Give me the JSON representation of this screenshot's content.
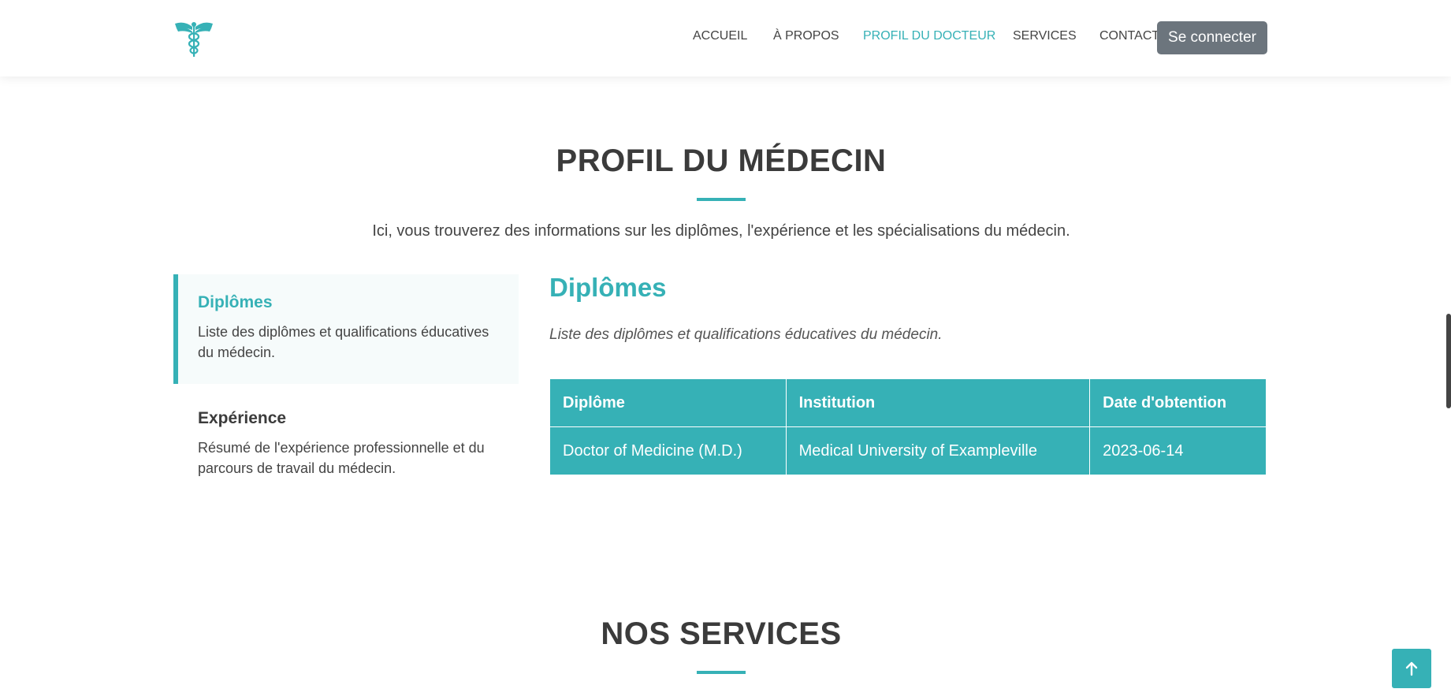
{
  "nav": {
    "items": [
      {
        "label": "ACCUEIL",
        "active": false
      },
      {
        "label": "À PROPOS",
        "active": false
      },
      {
        "label": "PROFIL DU DOCTEUR",
        "active": true
      },
      {
        "label": "SERVICES",
        "active": false
      },
      {
        "label": "CONTACT",
        "active": false
      }
    ],
    "login_label": "Se connecter"
  },
  "profile": {
    "title": "PROFIL DU MÉDECIN",
    "description": "Ici, vous trouverez des informations sur les diplômes, l'expérience et les spécialisations du médecin.",
    "tabs": [
      {
        "title": "Diplômes",
        "text": "Liste des diplômes et qualifications éducatives du médecin.",
        "active": true
      },
      {
        "title": "Expérience",
        "text": "Résumé de l'expérience professionnelle et du parcours de travail du médecin.",
        "active": false
      }
    ],
    "content": {
      "title": "Diplômes",
      "description": "Liste des diplômes et qualifications éducatives du médecin.",
      "table": {
        "headers": [
          "Diplôme",
          "Institution",
          "Date d'obtention"
        ],
        "rows": [
          [
            "Doctor of Medicine (M.D.)",
            "Medical University of Exampleville",
            "2023-06-14"
          ]
        ]
      }
    }
  },
  "services": {
    "title": "NOS SERVICES"
  },
  "colors": {
    "accent": "#36b1b6",
    "login_button": "#6c757d",
    "heading": "#3b3b3b"
  },
  "icons": {
    "logo": "caduceus-icon",
    "back_to_top": "arrow-up-icon"
  }
}
